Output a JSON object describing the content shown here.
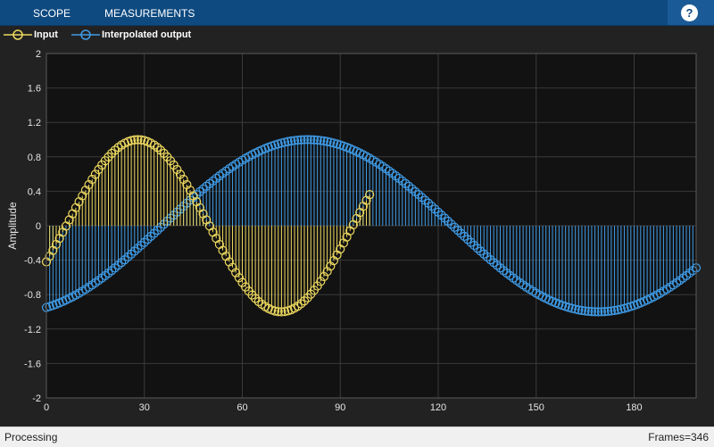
{
  "toolbar": {
    "tabs": [
      {
        "label": "SCOPE"
      },
      {
        "label": "MEASUREMENTS"
      }
    ],
    "help_label": "?"
  },
  "legend": [
    {
      "label": "Input",
      "color": "#edd85f"
    },
    {
      "label": "Interpolated output",
      "color": "#3f9be6"
    }
  ],
  "status": {
    "left": "Processing",
    "right": "Frames=346"
  },
  "chart_data": {
    "type": "stem",
    "ylabel": "Amplitude",
    "xlim": [
      0,
      199
    ],
    "ylim": [
      -2,
      2
    ],
    "xticks": [
      0,
      30,
      60,
      90,
      120,
      150,
      180
    ],
    "yticks": [
      -2,
      -1.6,
      -1.2,
      -0.8,
      -0.4,
      0,
      0.4,
      0.8,
      1.2,
      1.6,
      2
    ],
    "grid": true,
    "legend_position": "top-left",
    "series": [
      {
        "name": "Input",
        "color": "#edd85f",
        "marker": "circle",
        "x_start": 0,
        "x_end": 99,
        "values_approx": {
          "x0": -0.42,
          "peak_x": 28,
          "peak_y": 1.0,
          "trough_x": 72,
          "trough_y": -1.0,
          "x99": 0.37
        }
      },
      {
        "name": "Interpolated output",
        "color": "#3f9be6",
        "marker": "circle",
        "x_start": 0,
        "x_end": 199,
        "values_approx": {
          "x0": -0.95,
          "peak_x": 80,
          "peak_y": 1.0,
          "trough_x": 167,
          "trough_y": -1.0,
          "x199": -0.44
        }
      }
    ]
  }
}
